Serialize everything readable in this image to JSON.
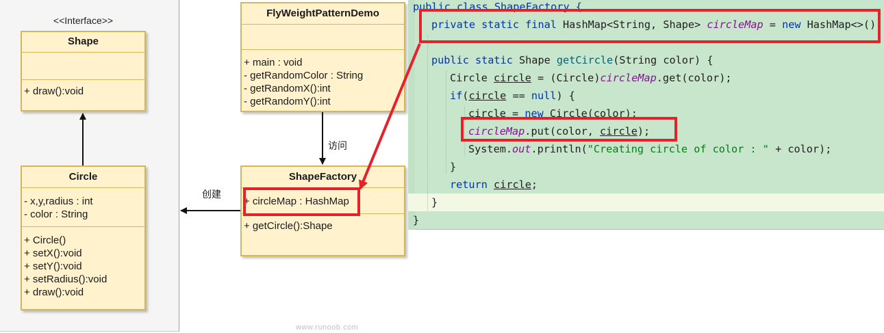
{
  "interface_stereotype": "<<Interface>>",
  "classes": {
    "shape": {
      "name": "Shape",
      "attributes": [],
      "methods": [
        "+ draw():void"
      ]
    },
    "circle": {
      "name": "Circle",
      "attributes": [
        "- x,y,radius : int",
        "- color : String"
      ],
      "methods": [
        "+ Circle()",
        "+ setX():void",
        "+ setY():void",
        "+ setRadius():void",
        "+ draw():void"
      ]
    },
    "demo": {
      "name": "FlyWeightPatternDemo",
      "attributes": [],
      "methods": [
        "+ main : void",
        "- getRandomColor : String",
        "- getRandomX():int",
        "- getRandomY():int"
      ]
    },
    "factory": {
      "name": "ShapeFactory",
      "attributes": [
        "+ circleMap : HashMap"
      ],
      "methods": [
        "+ getCircle():Shape"
      ]
    }
  },
  "relations": {
    "create_label": "创建",
    "access_label": "访问"
  },
  "code": {
    "l0": [
      "public class ShapeFactory {"
    ],
    "l1": [
      "private static final",
      " HashMap<String, Shape> ",
      "circleMap",
      " = ",
      "new",
      " HashMap<>();"
    ],
    "l3": [
      "public static",
      " Shape ",
      "getCircle",
      "(String color) {"
    ],
    "l4": [
      "Circle ",
      "circle",
      " = (Circle)",
      "circleMap",
      ".get(color);"
    ],
    "l5": [
      "if",
      "(",
      "circle",
      " == ",
      "null",
      ") {"
    ],
    "l6": [
      "circle",
      " = ",
      "new",
      " Circle(color);"
    ],
    "l7": [
      "circleMap",
      ".put(color, ",
      "circle",
      ");"
    ],
    "l8": [
      "System.",
      "out",
      ".println(",
      "\"Creating circle of color : \"",
      " + color);"
    ],
    "l9": [
      "}"
    ],
    "l10": [
      "return",
      " ",
      "circle",
      ";"
    ],
    "l11": [
      "}"
    ],
    "l12": [
      "}"
    ]
  },
  "watermark": "www.runoob.com",
  "colors": {
    "class_fill": "#fff2cc",
    "class_border": "#d6b656",
    "code_bg": "#c7e6cc",
    "highlight": "#e5222a",
    "keyword": "#0033b3",
    "field": "#871094",
    "string": "#067d17"
  }
}
